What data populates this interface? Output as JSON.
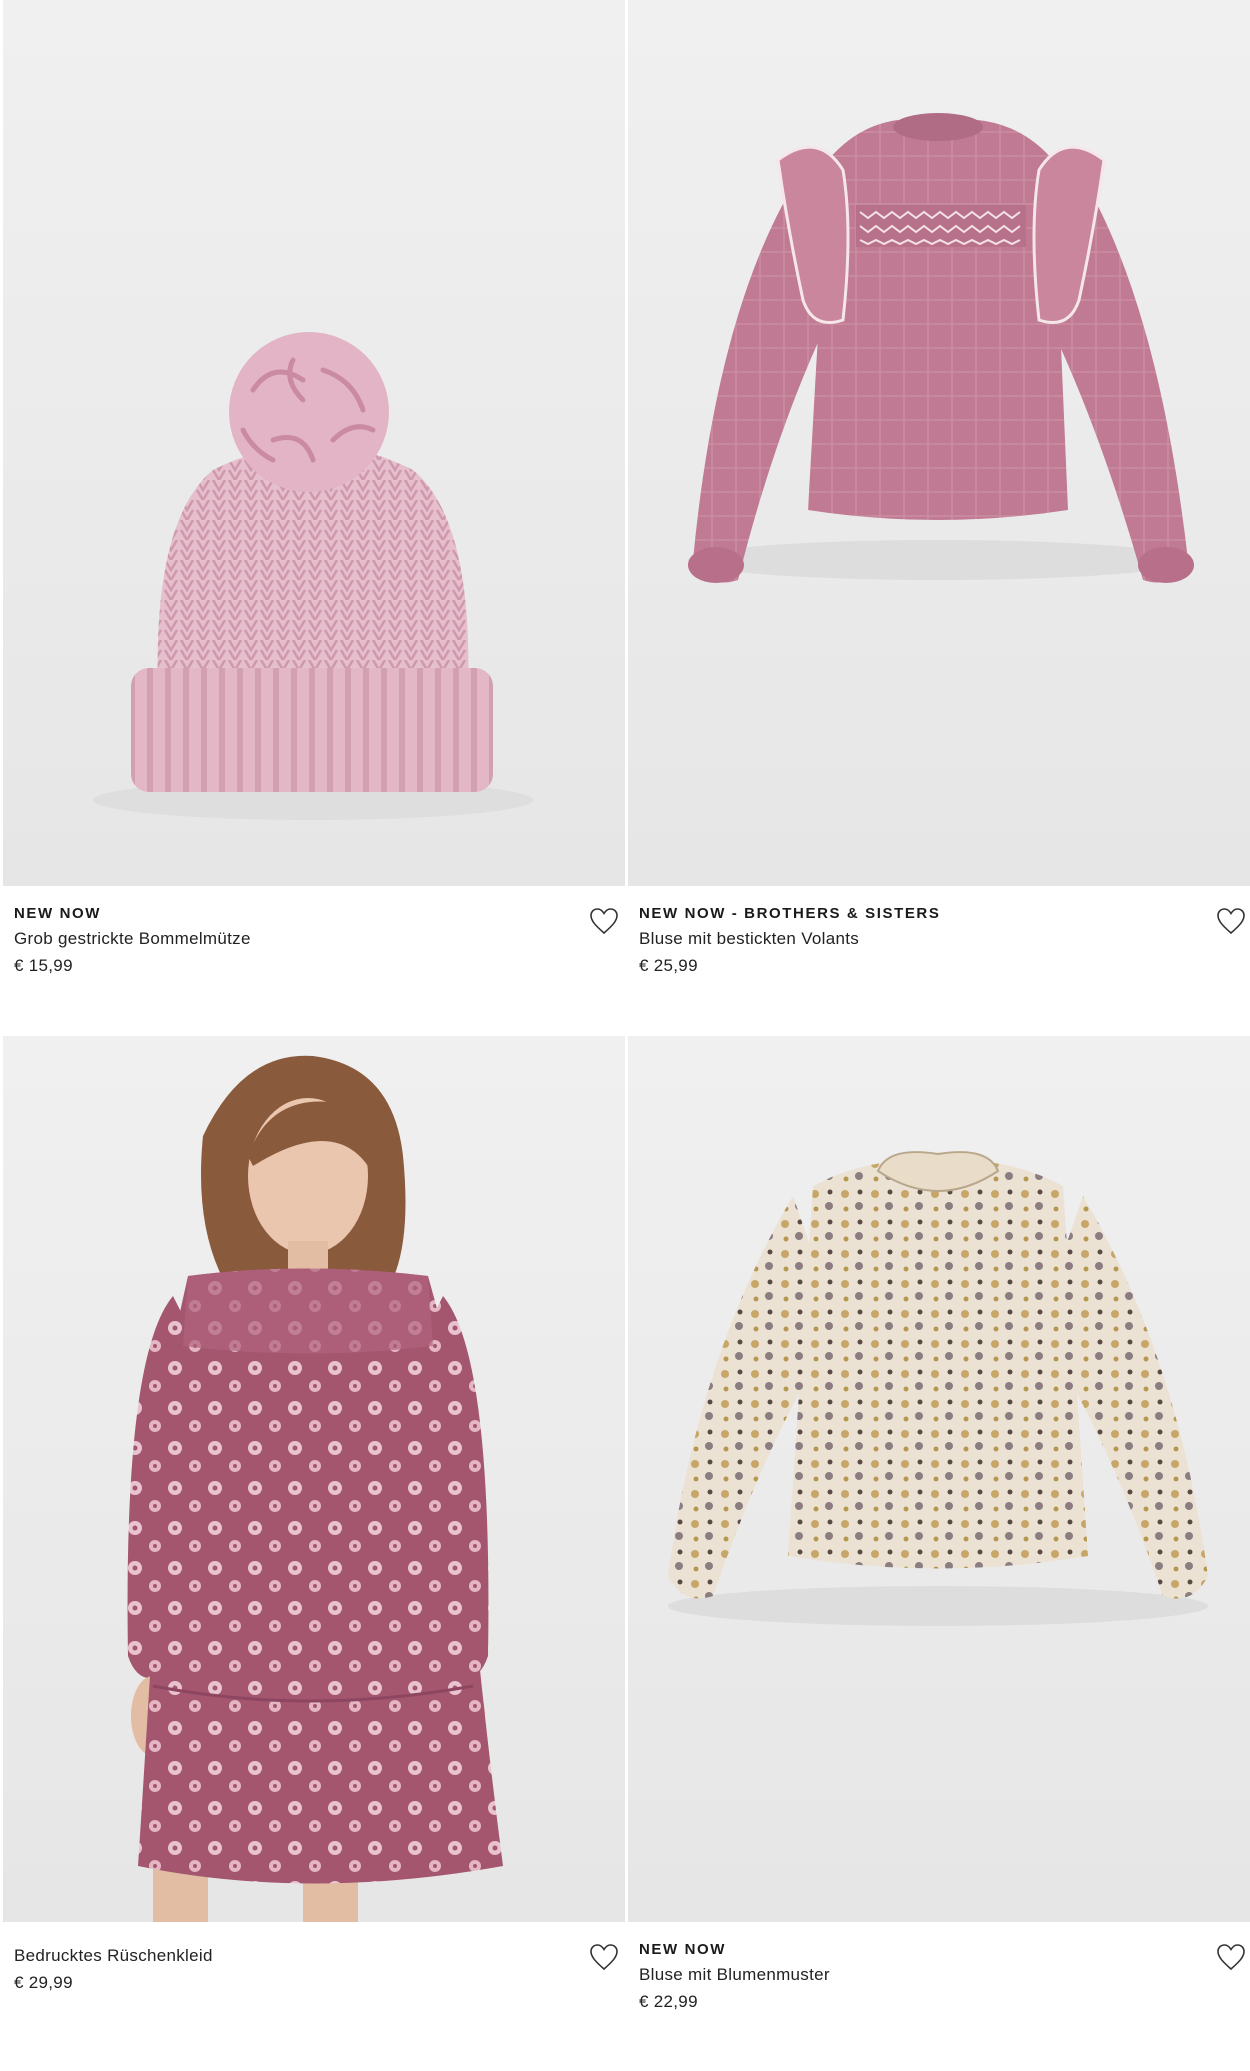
{
  "products": [
    {
      "tag": "NEW NOW",
      "name": "Grob gestrickte Bommelmütze",
      "price": "€ 15,99",
      "favorite_icon": "heart-outline-icon"
    },
    {
      "tag": "NEW NOW - BROTHERS & SISTERS",
      "name": "Bluse mit bestickten Volants",
      "price": "€ 25,99",
      "favorite_icon": "heart-outline-icon"
    },
    {
      "tag": "",
      "name": "Bedrucktes Rüschenkleid",
      "price": "€ 29,99",
      "favorite_icon": "heart-outline-icon"
    },
    {
      "tag": "NEW NOW",
      "name": "Bluse mit Blumenmuster",
      "price": "€ 22,99",
      "favorite_icon": "heart-outline-icon"
    }
  ],
  "colors": {
    "background": "#ffffff",
    "image_background": "#ebebeb",
    "text": "#1a1a1a",
    "hat_pink": "#e3b5c6",
    "blouse_pink": "#c0768f",
    "dress_berry": "#a45670",
    "floral_beige": "#e9dccb"
  }
}
